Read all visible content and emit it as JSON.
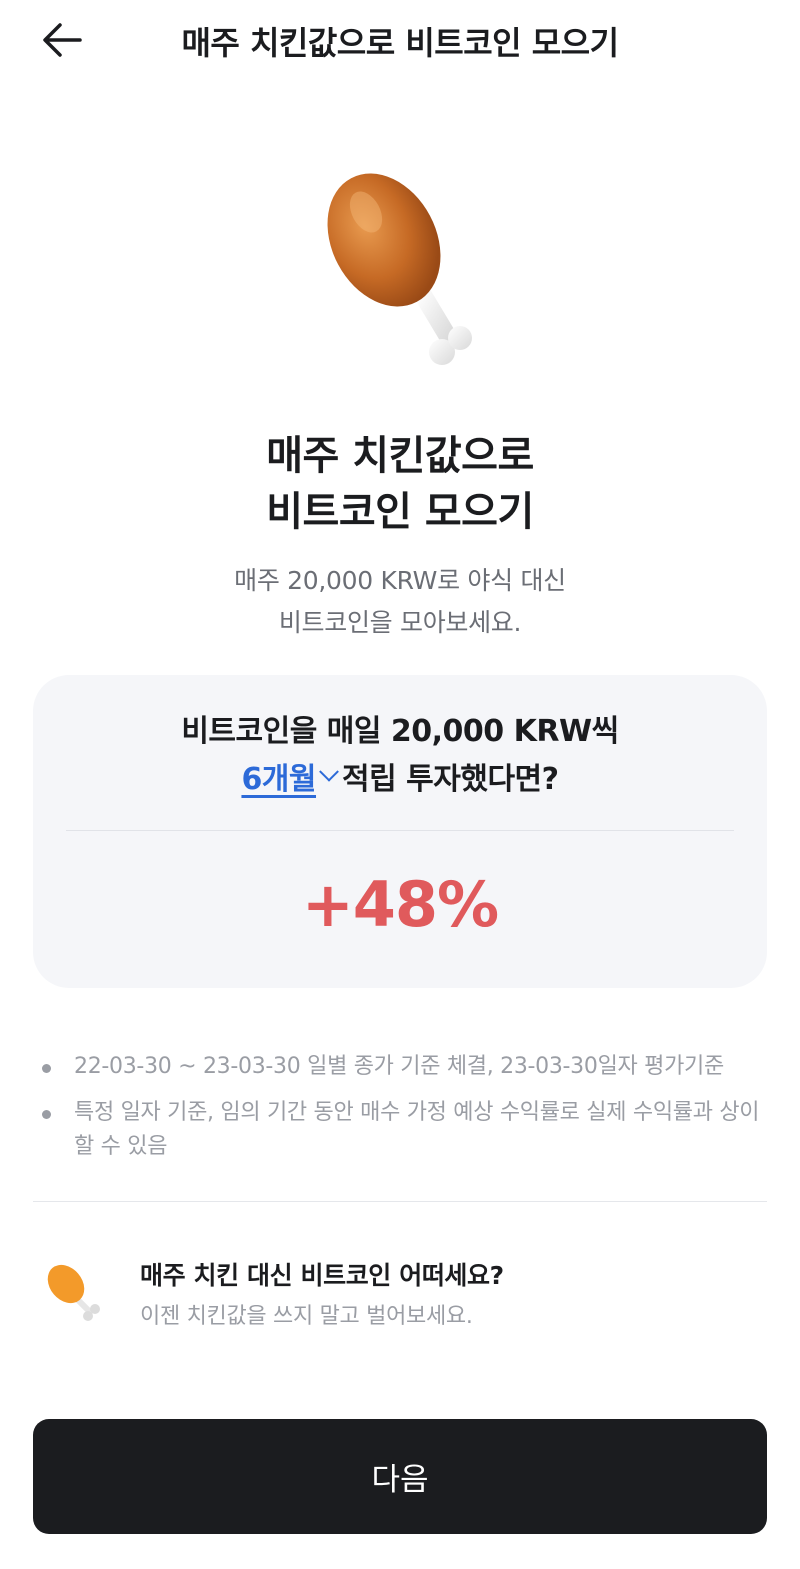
{
  "header": {
    "title": "매주 치킨값으로 비트코인 모으기",
    "back_icon": "arrow-left-icon"
  },
  "hero": {
    "image_icon": "chicken-drumstick-icon",
    "title_line1": "매주 치킨값으로",
    "title_line2": "비트코인 모으기",
    "subtitle_line1": "매주 20,000 KRW로 야식 대신",
    "subtitle_line2": "비트코인을 모아보세요."
  },
  "simulation": {
    "line1": "비트코인을 매일 20,000 KRW씩",
    "period": "6개월",
    "line2_suffix": "적립 투자했다면?",
    "result": "+48%",
    "result_color": "#e05a5c",
    "period_color": "#2c6ad8"
  },
  "notes": [
    "22-03-30 ~ 23-03-30 일별 종가 기준 체결, 23-03-30일자 평가기준",
    "특정 일자 기준, 임의 기간 동안 매수 가정 예상 수익률로 실제 수익률과 상이할 수 있음"
  ],
  "promo": {
    "icon": "chicken-drumstick-icon",
    "title": "매주 치킨 대신 비트코인 어떠세요?",
    "subtitle": "이젠 치킨값을 쓰지 말고 벌어보세요."
  },
  "cta": {
    "label": "다음"
  }
}
